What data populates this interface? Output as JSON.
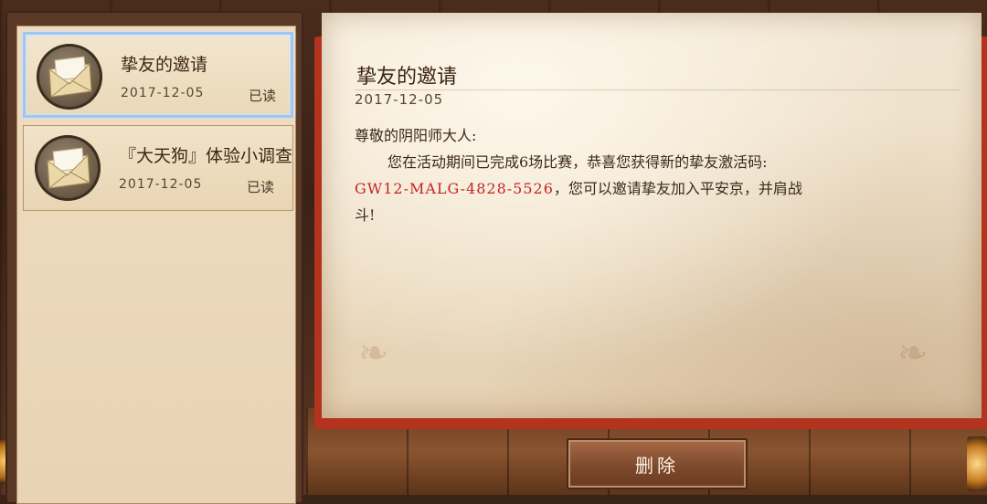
{
  "mail_list": [
    {
      "title": "挚友的邀请",
      "date": "2017-12-05",
      "status": "已读",
      "selected": true
    },
    {
      "title": "『大天狗』体验小调查",
      "date": "2017-12-05",
      "status": "已读",
      "selected": false
    }
  ],
  "letter": {
    "title": "挚友的邀请",
    "date": "2017-12-05",
    "salutation": "尊敬的阴阳师大人:",
    "line1": "您在活动期间已完成6场比赛，恭喜您获得新的挚友激活码:",
    "code": "GW12-MALG-4828-5526",
    "line2_after_code": "，您可以邀请挚友加入平安京，并肩战",
    "line3": "斗!"
  },
  "delete_button": {
    "label": "删除"
  },
  "colors": {
    "accent_code": "#c62424",
    "selected_border": "#9fc6f5",
    "button_bg": "#7e4a2d"
  }
}
